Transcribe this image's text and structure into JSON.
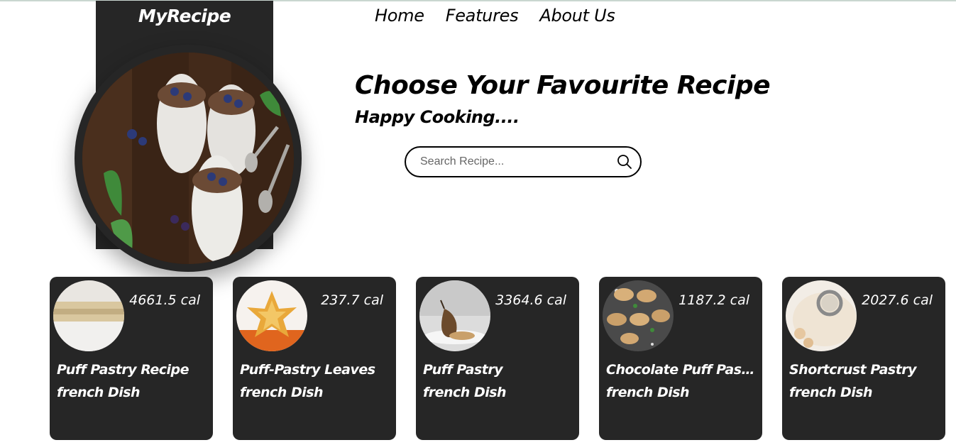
{
  "brand": {
    "name": "MyRecipe"
  },
  "nav": {
    "items": [
      "Home",
      "Features",
      "About Us"
    ]
  },
  "hero": {
    "headline": "Choose Your Favourite Recipe",
    "subline": "Happy Cooking...."
  },
  "search": {
    "placeholder": "Search Recipe...",
    "value": "",
    "icon": "search-icon"
  },
  "recipes": [
    {
      "calories": "4661.5 cal",
      "title": "Puff Pastry Recipe",
      "cuisine": "french Dish"
    },
    {
      "calories": "237.7 cal",
      "title": "Puff-Pastry Leaves",
      "cuisine": "french Dish"
    },
    {
      "calories": "3364.6 cal",
      "title": "Puff Pastry",
      "cuisine": "french Dish"
    },
    {
      "calories": "1187.2 cal",
      "title": "Chocolate Puff Past...",
      "cuisine": "french Dish"
    },
    {
      "calories": "2027.6 cal",
      "title": "Shortcrust Pastry",
      "cuisine": "french Dish"
    }
  ],
  "colors": {
    "card_bg": "#262626",
    "text_on_dark": "#ffffff",
    "accent_rule": "#c9d6d0"
  }
}
